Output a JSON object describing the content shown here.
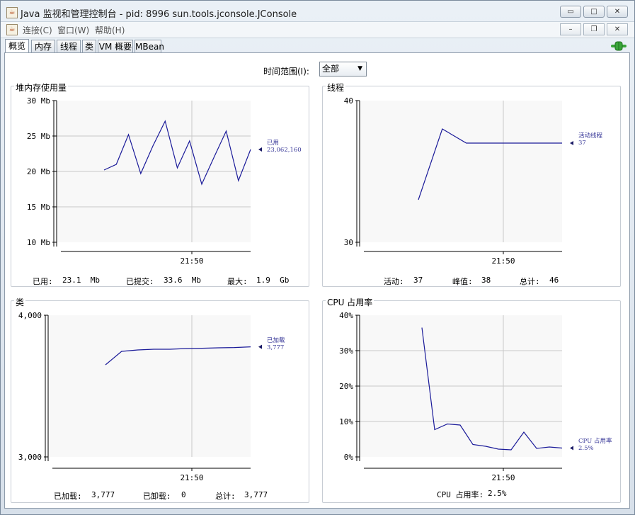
{
  "window": {
    "title": "Java 监视和管理控制台 - pid: 8996 sun.tools.jconsole.JConsole",
    "icon": "java-cup-icon",
    "buttons": {
      "minimize": "▭",
      "maximize": "□",
      "close": "✕"
    }
  },
  "menu": {
    "items": [
      {
        "label": "连接(C)"
      },
      {
        "label": "窗口(W)"
      },
      {
        "label": "帮助(H)"
      }
    ],
    "inner_buttons": {
      "minimize": "–",
      "restore": "❐",
      "close": "✕"
    }
  },
  "tabs": [
    {
      "label": "概览",
      "active": true
    },
    {
      "label": "内存",
      "active": false
    },
    {
      "label": "线程",
      "active": false
    },
    {
      "label": "类",
      "active": false
    },
    {
      "label": "VM 概要",
      "active": false
    },
    {
      "label": "MBean",
      "active": false
    }
  ],
  "time_range": {
    "label": "时间范围(I):",
    "value": "全部"
  },
  "colors": {
    "series": "#1a1a99",
    "grid": "#c8c8c8",
    "axis": "#000000",
    "plot_bg": "#f8f8f8",
    "connection_icon": "#3aa53a"
  },
  "chart_data": [
    {
      "id": "heap",
      "type": "line",
      "title": "堆内存使用量",
      "y_ticks": [
        "30 Mb",
        "25 Mb",
        "20 Mb",
        "15 Mb",
        "10 Mb"
      ],
      "ylim": [
        10,
        30
      ],
      "x_tick": "21:50",
      "legend": {
        "name": "已用",
        "value": "23,062,160"
      },
      "series": [
        {
          "name": "已用",
          "x": [
            0,
            1,
            2,
            3,
            4,
            5,
            6,
            7,
            8,
            9,
            10,
            11,
            12
          ],
          "values": [
            20.2,
            21.0,
            25.2,
            19.7,
            23.6,
            27.1,
            20.5,
            24.3,
            18.2,
            22.0,
            25.7,
            18.7,
            23.1
          ]
        }
      ],
      "stats": [
        {
          "label": "已用:",
          "value": "23.1  Mb"
        },
        {
          "label": "已提交:",
          "value": "33.6  Mb"
        },
        {
          "label": "最大:",
          "value": "1.9  Gb"
        }
      ]
    },
    {
      "id": "threads",
      "type": "line",
      "title": "线程",
      "y_ticks": [
        "40",
        "30"
      ],
      "ylim": [
        30,
        40
      ],
      "x_tick": "21:50",
      "legend": {
        "name": "活动线程",
        "value": "37"
      },
      "series": [
        {
          "name": "活动线程",
          "x": [
            0,
            1,
            2,
            3,
            4,
            5,
            6
          ],
          "values": [
            33,
            38,
            37,
            37,
            37,
            37,
            37
          ]
        }
      ],
      "stats": [
        {
          "label": "活动:",
          "value": "37"
        },
        {
          "label": "峰值:",
          "value": "38"
        },
        {
          "label": "总计:",
          "value": "46"
        }
      ]
    },
    {
      "id": "classes",
      "type": "line",
      "title": "类",
      "y_ticks": [
        "4,000",
        "3,000"
      ],
      "ylim": [
        3000,
        4000
      ],
      "x_tick": "21:50",
      "legend": {
        "name": "已加载",
        "value": "3,777"
      },
      "series": [
        {
          "name": "已加载",
          "x": [
            0,
            1,
            2,
            3,
            4,
            5,
            6,
            7,
            8,
            9
          ],
          "values": [
            3650,
            3745,
            3755,
            3760,
            3760,
            3765,
            3767,
            3770,
            3772,
            3777
          ]
        }
      ],
      "stats": [
        {
          "label": "已加载:",
          "value": "3,777"
        },
        {
          "label": "已卸载:",
          "value": "0"
        },
        {
          "label": "总计:",
          "value": "3,777"
        }
      ]
    },
    {
      "id": "cpu",
      "type": "line",
      "title": "CPU 占用率",
      "y_ticks": [
        "40%",
        "30%",
        "20%",
        "10%",
        "0%"
      ],
      "ylim": [
        0,
        40
      ],
      "x_tick": "21:50",
      "legend": {
        "name": "CPU 占用率",
        "value": "2.5%"
      },
      "series": [
        {
          "name": "CPU 占用率",
          "x": [
            0,
            1,
            2,
            3,
            4,
            5,
            6,
            7,
            8,
            9,
            10,
            11
          ],
          "values": [
            36.5,
            7.7,
            9.3,
            9.0,
            3.5,
            3.0,
            2.2,
            2.0,
            7.0,
            2.4,
            2.8,
            2.5
          ]
        }
      ],
      "stats": [
        {
          "label": "CPU 占用率:",
          "value": "2.5%"
        }
      ]
    }
  ]
}
